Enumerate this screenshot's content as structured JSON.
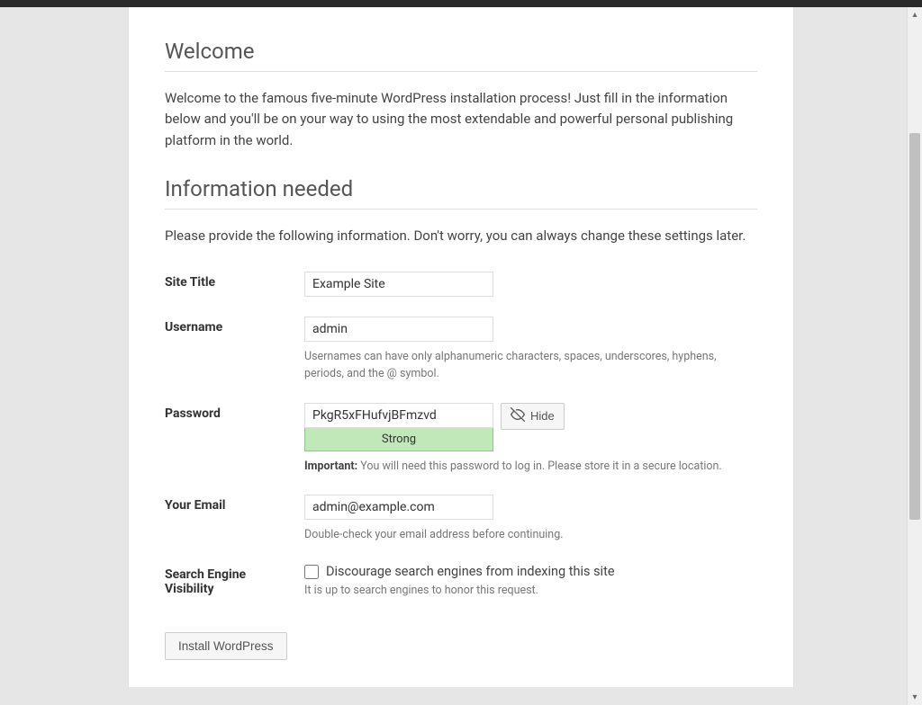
{
  "headings": {
    "welcome": "Welcome",
    "welcome_text": "Welcome to the famous five-minute WordPress installation process! Just fill in the information below and you'll be on your way to using the most extendable and powerful personal publishing platform in the world.",
    "info": "Information needed",
    "info_text": "Please provide the following information. Don't worry, you can always change these settings later."
  },
  "fields": {
    "site_title": {
      "label": "Site Title",
      "value": "Example Site"
    },
    "username": {
      "label": "Username",
      "value": "admin",
      "hint": "Usernames can have only alphanumeric characters, spaces, underscores, hyphens, periods, and the @ symbol."
    },
    "password": {
      "label": "Password",
      "value": "PkgR5xFHufvjBFmzvd",
      "strength": "Strong",
      "hide_btn": "Hide",
      "important_label": "Important:",
      "important_text": " You will need this password to log in. Please store it in a secure location."
    },
    "email": {
      "label": "Your Email",
      "value": "admin@example.com",
      "hint": "Double-check your email address before continuing."
    },
    "search": {
      "label": "Search Engine Visibility",
      "checkbox_label": "Discourage search engines from indexing this site",
      "hint": "It is up to search engines to honor this request.",
      "checked": false
    }
  },
  "submit": {
    "label": "Install WordPress"
  }
}
